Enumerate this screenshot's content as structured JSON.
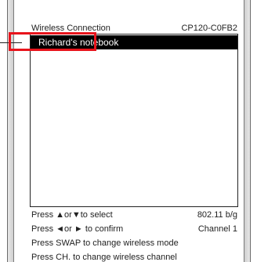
{
  "header": {
    "title": "Wireless Connection",
    "device_id": "CP120-C0FB2"
  },
  "network_list": {
    "items": [
      {
        "label": "Richard's notebook",
        "selected": true
      }
    ]
  },
  "footer": {
    "rows": [
      {
        "left": "Press ▲or▼to select",
        "right": "802.11 b/g"
      },
      {
        "left": "Press ◄or ► to confirm",
        "right": "Channel 1"
      },
      {
        "left": "Press SWAP to change wireless mode",
        "right": ""
      },
      {
        "left": "Press CH. to change wireless channel",
        "right": ""
      }
    ]
  },
  "colors": {
    "highlight": "#e8141c",
    "selection_bg": "#000000",
    "selection_text": "#ffffff"
  }
}
